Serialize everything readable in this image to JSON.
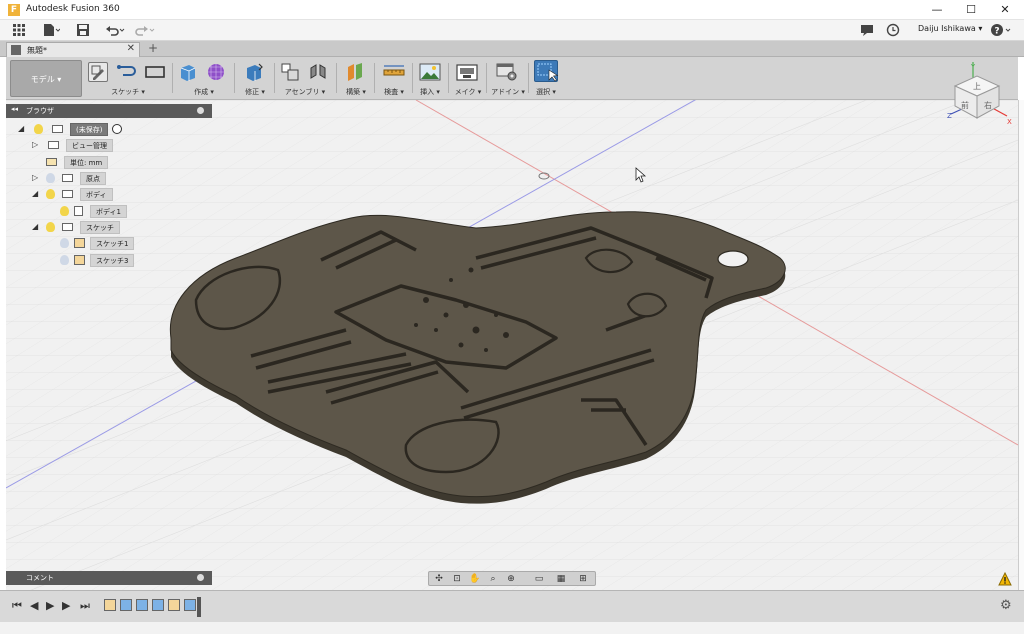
{
  "window": {
    "title": "Autodesk Fusion 360",
    "controls": {
      "minimize": "—",
      "maximize": "☐",
      "close": "✕"
    }
  },
  "appbar": {
    "user": "Daiju Ishikawa ▾",
    "help": "?"
  },
  "tab": {
    "label": "無題*",
    "close": "✕",
    "add": "+"
  },
  "toolbar": {
    "mode": "モデル ▾",
    "groups": [
      {
        "id": "sketch",
        "label": "スケッチ ▾"
      },
      {
        "id": "create",
        "label": "作成 ▾"
      },
      {
        "id": "modify",
        "label": "修正 ▾"
      },
      {
        "id": "assemble",
        "label": "アセンブリ ▾"
      },
      {
        "id": "construct",
        "label": "構築 ▾"
      },
      {
        "id": "inspect",
        "label": "検査 ▾"
      },
      {
        "id": "insert",
        "label": "挿入 ▾"
      },
      {
        "id": "make",
        "label": "メイク ▾"
      },
      {
        "id": "addins",
        "label": "アドイン ▾"
      },
      {
        "id": "select",
        "label": "選択 ▾"
      }
    ]
  },
  "browser": {
    "title": "ブラウザ",
    "nodes": [
      {
        "label": "(未保存)"
      },
      {
        "label": "ビュー管理"
      },
      {
        "label": "単位: mm"
      },
      {
        "label": "原点"
      },
      {
        "label": "ボディ"
      },
      {
        "label": "ボディ1"
      },
      {
        "label": "スケッチ"
      },
      {
        "label": "スケッチ1"
      },
      {
        "label": "スケッチ3"
      }
    ]
  },
  "comment": {
    "title": "コメント"
  },
  "viewcube": {
    "top": "上",
    "front": "前",
    "right": "右",
    "axis_x": "X",
    "axis_y": "Y",
    "axis_z": "Z"
  },
  "colors": {
    "model_top": "#5d5649",
    "model_side": "#3e392f",
    "grid": "#dcdcdc",
    "axis_red": "#e37a7a",
    "axis_blue": "#7a7ae3",
    "select_blue": "#3d7ab8"
  }
}
